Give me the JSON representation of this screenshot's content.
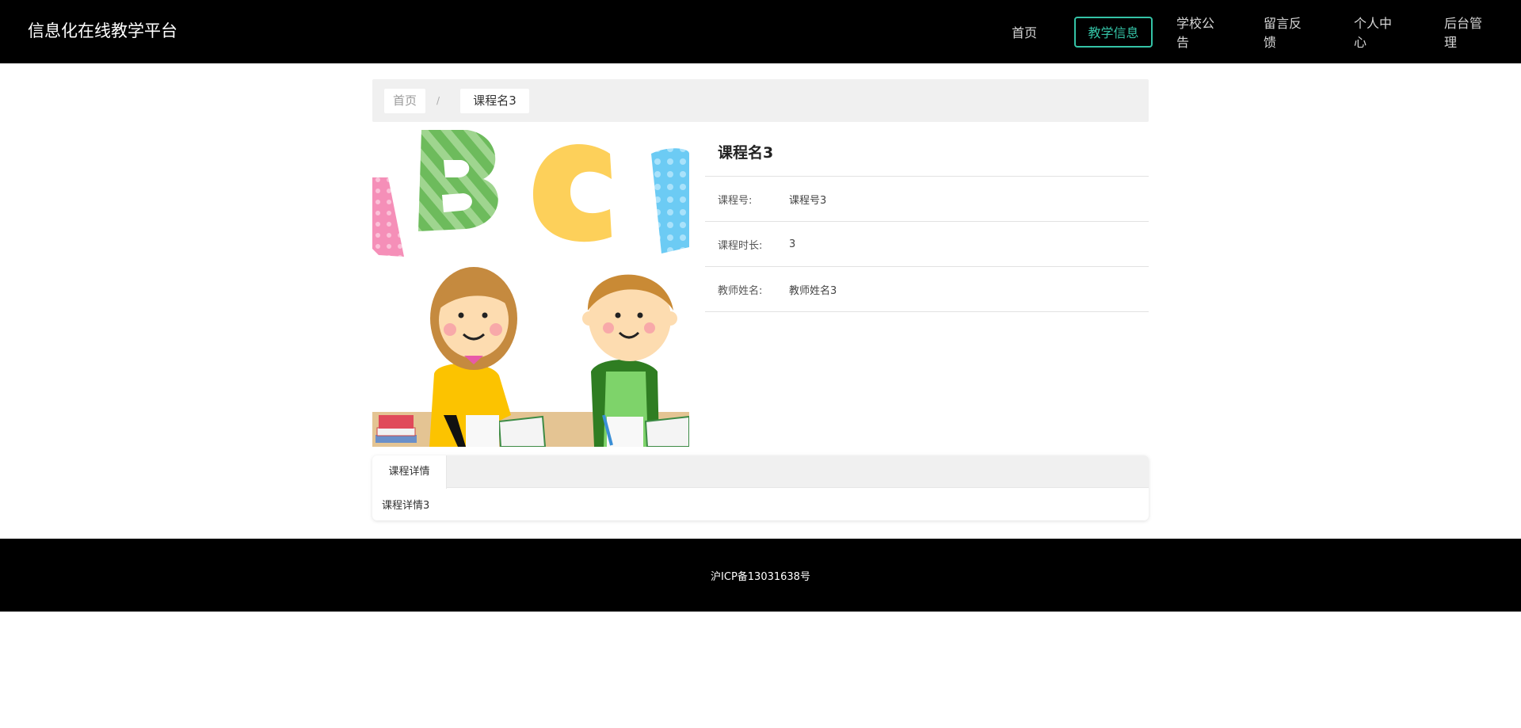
{
  "header": {
    "title": "信息化在线教学平台",
    "nav": [
      {
        "label": "首页",
        "active": false
      },
      {
        "label": "教学信息",
        "active": true
      },
      {
        "label": "学校公告",
        "active": false
      },
      {
        "label": "留言反馈",
        "active": false
      },
      {
        "label": "个人中心",
        "active": false
      },
      {
        "label": "后台管理",
        "active": false
      }
    ]
  },
  "breadcrumb": {
    "home": "首页",
    "separator": "/",
    "current": "课程名3"
  },
  "course": {
    "name": "课程名3",
    "fields": [
      {
        "label": "课程号:",
        "value": "课程号3"
      },
      {
        "label": "课程时长:",
        "value": "3"
      },
      {
        "label": "教师姓名:",
        "value": "教师姓名3"
      }
    ]
  },
  "tabs": {
    "active_label": "课程详情",
    "content": "课程详情3"
  },
  "footer": {
    "icp": "沪ICP备13031638号"
  },
  "colors": {
    "accent": "#34c3a6",
    "topbar": "#000000",
    "footer": "#000000",
    "panel_bg": "#f0f0f0"
  }
}
